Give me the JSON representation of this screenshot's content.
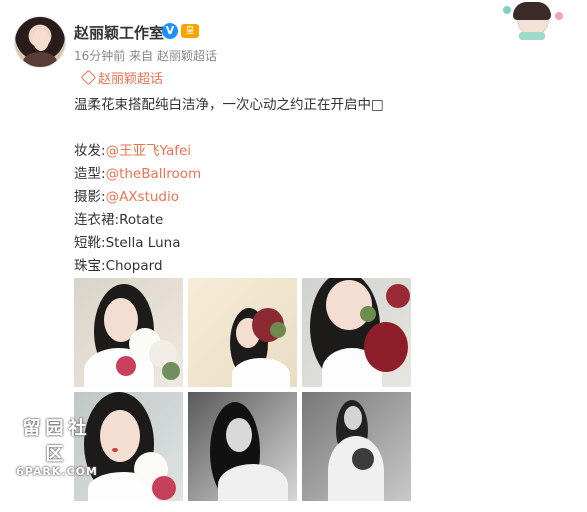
{
  "post": {
    "username": "赵丽颖工作室",
    "verified_badge": "V",
    "crown_badge": "皇",
    "time": "16分钟前",
    "from_label": "来自",
    "source": "赵丽颖超话",
    "topic_link": "赵丽颖超话",
    "text": "温柔花束搭配纯白洁净，一次心动之约正在开启中□",
    "credits": [
      {
        "label": "妆发:",
        "value": "@王亚飞Yafei",
        "is_mention": true
      },
      {
        "label": "造型:",
        "value": "@theBallroom",
        "is_mention": true
      },
      {
        "label": "摄影:",
        "value": "@AXstudio",
        "is_mention": true
      },
      {
        "label": "连衣裙:",
        "value": "Rotate",
        "is_mention": false
      },
      {
        "label": "短靴:",
        "value": "Stella Luna",
        "is_mention": false
      },
      {
        "label": "珠宝:",
        "value": "Chopard",
        "is_mention": false
      }
    ]
  },
  "watermark": {
    "cn": "留园社区",
    "en": "6PARK.COM"
  },
  "colors": {
    "mention": "#eb7350",
    "verified": "#1e90ff",
    "text": "#333333",
    "meta": "#888888"
  },
  "icons": [
    "avatar",
    "verified-icon",
    "crown-icon",
    "topic-diamond-icon",
    "corner-avatar-icon"
  ],
  "images": [
    {
      "name": "photo-1",
      "alt": "woman with white peonies"
    },
    {
      "name": "photo-2",
      "alt": "woman with red flower bouquet"
    },
    {
      "name": "photo-3",
      "alt": "close-up with red peony"
    },
    {
      "name": "photo-4",
      "alt": "woman holding peonies"
    },
    {
      "name": "photo-5",
      "alt": "black and white portrait"
    },
    {
      "name": "photo-6",
      "alt": "black and white with bouquet"
    }
  ]
}
